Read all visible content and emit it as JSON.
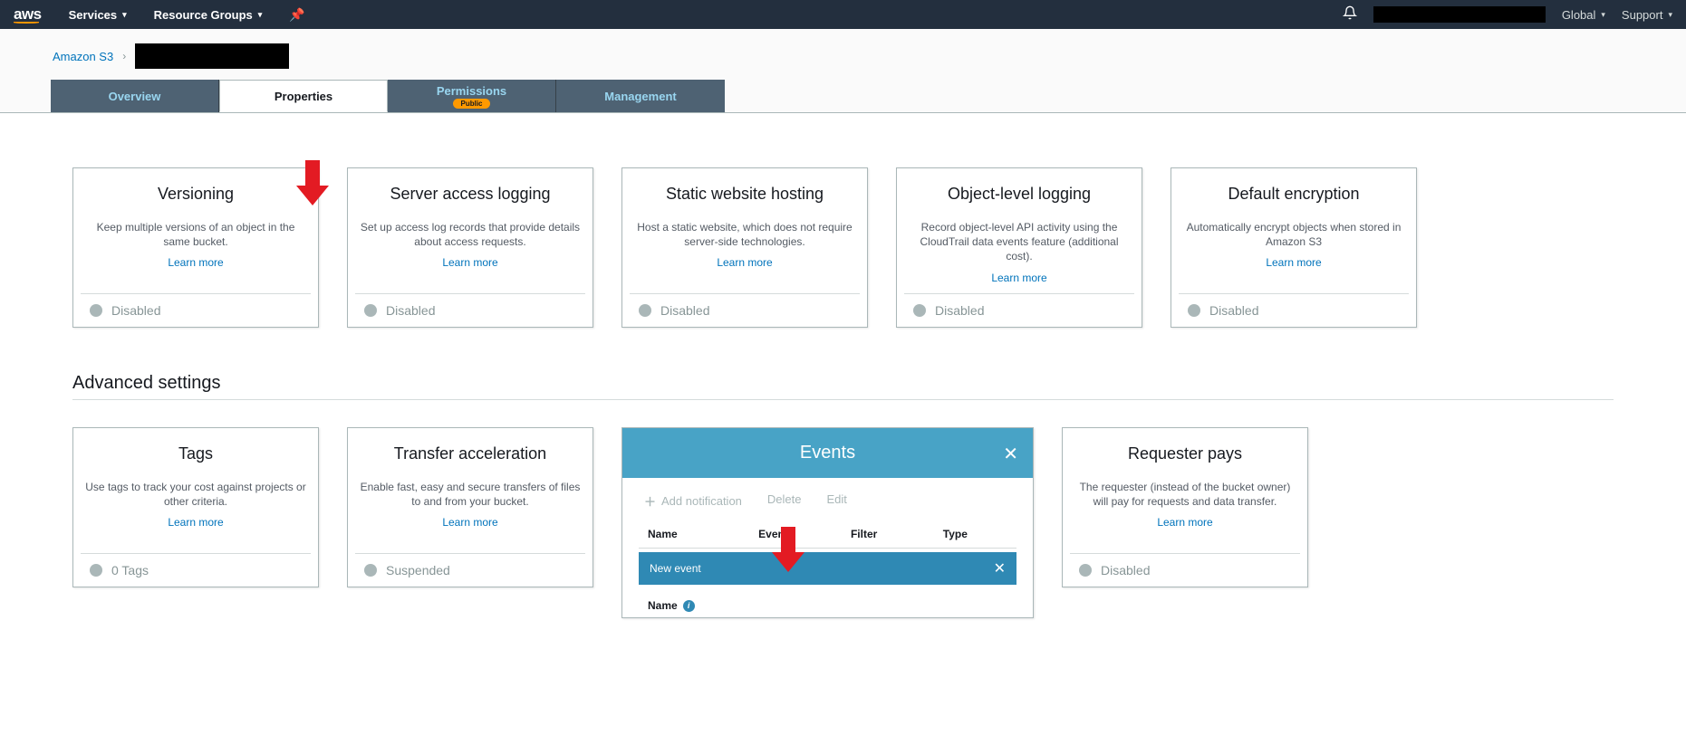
{
  "nav": {
    "services": "Services",
    "resource_groups": "Resource Groups",
    "global": "Global",
    "support": "Support"
  },
  "breadcrumb": {
    "root": "Amazon S3"
  },
  "tabs": {
    "overview": "Overview",
    "properties": "Properties",
    "permissions": "Permissions",
    "permissions_badge": "Public",
    "management": "Management"
  },
  "cards_row1": [
    {
      "title": "Versioning",
      "desc": "Keep multiple versions of an object in the same bucket.",
      "learn": "Learn more",
      "status": "Disabled"
    },
    {
      "title": "Server access logging",
      "desc": "Set up access log records that provide details about access requests.",
      "learn": "Learn more",
      "status": "Disabled"
    },
    {
      "title": "Static website hosting",
      "desc": "Host a static website, which does not require server-side technologies.",
      "learn": "Learn more",
      "status": "Disabled"
    },
    {
      "title": "Object-level logging",
      "desc": "Record object-level API activity using the CloudTrail data events feature (additional cost).",
      "learn": "Learn more",
      "status": "Disabled"
    },
    {
      "title": "Default encryption",
      "desc": "Automatically encrypt objects when stored in Amazon S3",
      "learn": "Learn more",
      "status": "Disabled"
    }
  ],
  "advanced": {
    "heading": "Advanced settings"
  },
  "cards_row2": {
    "tags": {
      "title": "Tags",
      "desc": "Use tags to track your cost against projects or other criteria.",
      "learn": "Learn more",
      "status": "0 Tags"
    },
    "transfer": {
      "title": "Transfer acceleration",
      "desc": "Enable fast, easy and secure transfers of files to and from your bucket.",
      "learn": "Learn more",
      "status": "Suspended"
    },
    "requester": {
      "title": "Requester pays",
      "desc": "The requester (instead of the bucket owner) will pay for requests and data transfer.",
      "learn": "Learn more",
      "status": "Disabled"
    }
  },
  "events_panel": {
    "title": "Events",
    "add": "Add notification",
    "delete": "Delete",
    "edit": "Edit",
    "cols": [
      "Name",
      "Events",
      "Filter",
      "Type"
    ],
    "new_row": "New event",
    "name_label": "Name"
  }
}
